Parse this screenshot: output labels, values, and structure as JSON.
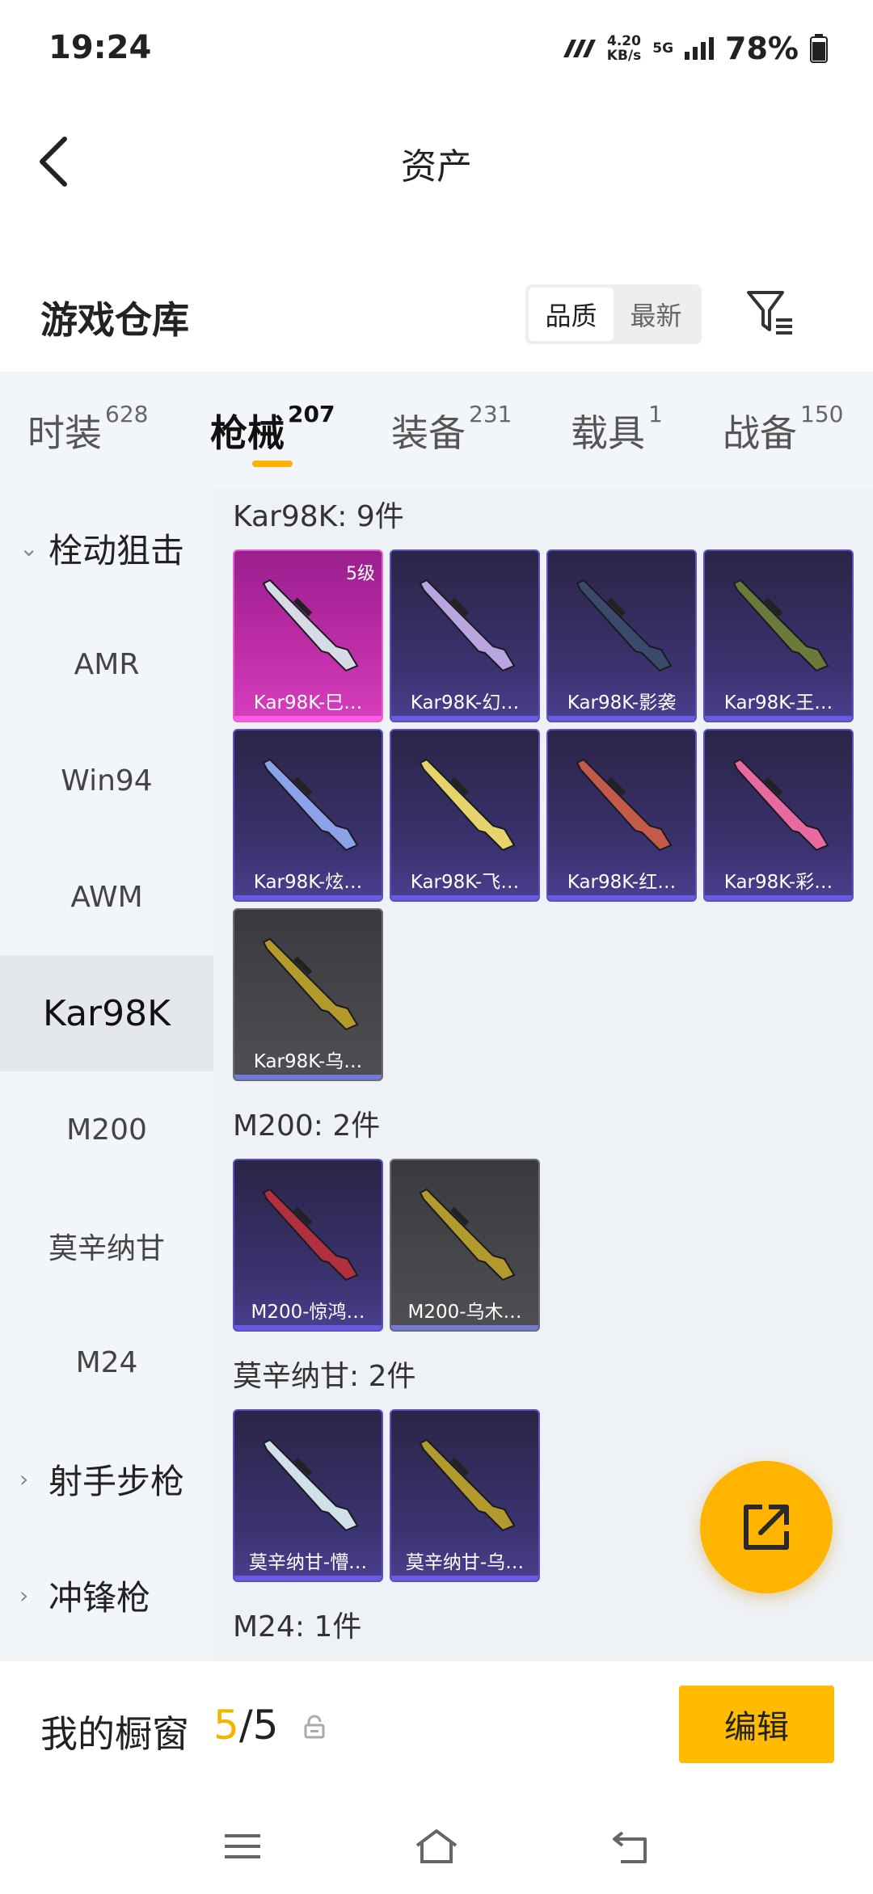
{
  "status": {
    "time": "19:24",
    "net_speed": "4.20",
    "net_unit": "KB/s",
    "network": "5G",
    "battery": "78%"
  },
  "header": {
    "title": "资产"
  },
  "warehouse": {
    "label": "游戏仓库",
    "sort_options": [
      "品质",
      "最新"
    ],
    "sort_active": "品质"
  },
  "tabs": [
    {
      "label": "时装",
      "count": "628"
    },
    {
      "label": "枪械",
      "count": "207"
    },
    {
      "label": "装备",
      "count": "231"
    },
    {
      "label": "载具",
      "count": "1"
    },
    {
      "label": "战备",
      "count": "150"
    }
  ],
  "active_tab": "枪械",
  "sidebar": {
    "groups": [
      {
        "label": "栓动狙击",
        "expanded": true
      },
      {
        "label": "射手步枪",
        "expanded": false
      },
      {
        "label": "冲锋枪",
        "expanded": false
      }
    ],
    "items": [
      "AMR",
      "Win94",
      "AWM",
      "Kar98K",
      "M200",
      "莫辛纳甘",
      "M24"
    ],
    "active_item": "Kar98K"
  },
  "sections": [
    {
      "title": "Kar98K: 9件",
      "cards": [
        {
          "name": "Kar98K-巳…",
          "level": "5级",
          "rarity": "gold",
          "gun_color": "#d7dbe6"
        },
        {
          "name": "Kar98K-幻…",
          "rarity": "purple",
          "gun_color": "#b9a6e0"
        },
        {
          "name": "Kar98K-影袭",
          "rarity": "purple",
          "gun_color": "#3a4a6a"
        },
        {
          "name": "Kar98K-王…",
          "rarity": "purple",
          "gun_color": "#6b7a3a"
        },
        {
          "name": "Kar98K-炫…",
          "rarity": "purple",
          "gun_color": "#8ba2e8"
        },
        {
          "name": "Kar98K-飞…",
          "rarity": "purple",
          "gun_color": "#e6d36a"
        },
        {
          "name": "Kar98K-红…",
          "rarity": "purple",
          "gun_color": "#c45a4a"
        },
        {
          "name": "Kar98K-彩…",
          "rarity": "purple",
          "gun_color": "#e86aa0"
        },
        {
          "name": "Kar98K-乌…",
          "rarity": "grey",
          "gun_color": "#b39a2c"
        }
      ]
    },
    {
      "title": "M200: 2件",
      "cards": [
        {
          "name": "M200-惊鸿…",
          "rarity": "purple",
          "gun_color": "#b03040"
        },
        {
          "name": "M200-乌木…",
          "rarity": "grey",
          "gun_color": "#b39a2c"
        }
      ]
    },
    {
      "title": "莫辛纳甘: 2件",
      "cards": [
        {
          "name": "莫辛纳甘-懵…",
          "rarity": "purple",
          "gun_color": "#cfe0ea"
        },
        {
          "name": "莫辛纳甘-乌…",
          "rarity": "purple",
          "gun_color": "#b39a2c"
        }
      ]
    },
    {
      "title": "M24: 1件",
      "cards": []
    }
  ],
  "showcase": {
    "label": "我的橱窗",
    "current": "5",
    "separator": "/",
    "total": "5",
    "edit_label": "编辑"
  },
  "colors": {
    "accent": "#ffbb00",
    "tab_bg": "#f2f5f9",
    "card_purple": "#3b3370",
    "card_gold": "#c02ea8",
    "card_grey": "#4f4f54"
  }
}
